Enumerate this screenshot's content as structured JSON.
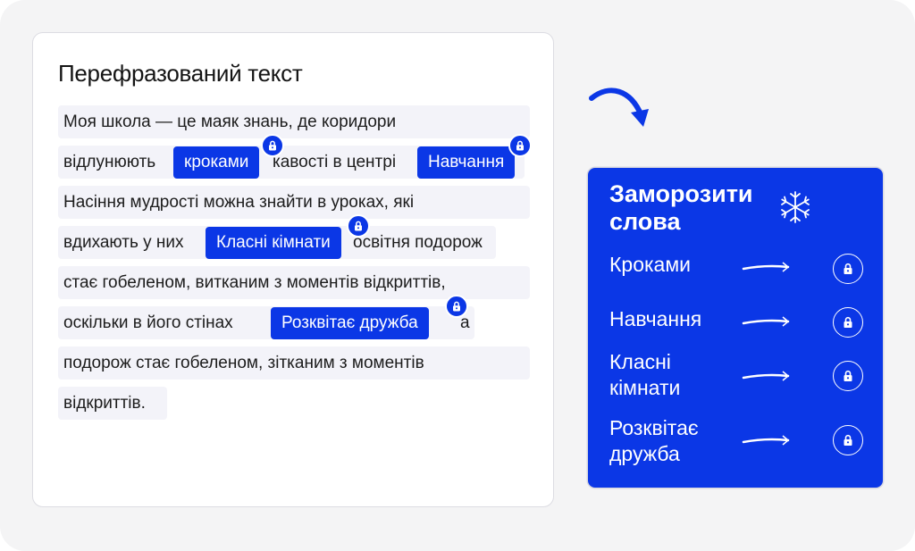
{
  "text_card": {
    "title": "Перефразований текст",
    "lines": [
      "Моя школа — це маяк знань, де коридори",
      "відлунюють",
      "кавості в центрі",
      "Насіння мудрості можна знайти в уроках, які",
      "вдихають у них",
      "освітня подорож",
      "стає гобеленом, витканим з моментів відкриттів,",
      "оскільки в його стінах",
      "а",
      "подорож стає гобеленом, зітканим з моментів",
      "відкриттів."
    ],
    "chips": [
      "кроками",
      "Навчання",
      "Класні кімнати",
      "Розквітає дружба"
    ]
  },
  "freeze_panel": {
    "title": "Заморозити слова",
    "icon": "snowflake-icon",
    "words": [
      "Кроками",
      "Навчання",
      "Класні кімнати",
      "Розквітає дружба"
    ]
  },
  "colors": {
    "accent": "#0b37e6",
    "line_bg": "#f3f3f9",
    "page_bg": "#f4f4f5"
  }
}
